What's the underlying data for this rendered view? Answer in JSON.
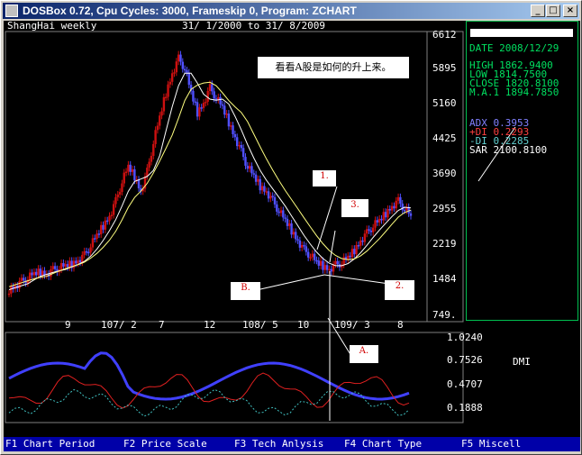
{
  "window": {
    "title": "DOSBox 0.72, Cpu Cycles:     3000, Frameskip  0, Program:   ZCHART",
    "minimize_glyph": "_",
    "maximize_glyph": "□",
    "close_glyph": "×"
  },
  "chart_header": {
    "symbol": "ShangHai weekly",
    "date_range": "31/ 1/2000 to 31/ 8/2009"
  },
  "annotation": {
    "caption": "看看A股是如何的升上来。",
    "labels": [
      "1.",
      "3.",
      "B.",
      "2.",
      "A."
    ]
  },
  "info": {
    "date": "DATE 2008/12/29",
    "high": "HIGH   1862.9400",
    "low": "LOW    1814.7500",
    "close": "CLOSE  1820.8100",
    "ma": "M.A.1  1894.7850",
    "adx": "ADX        0.3953",
    "pdi": "+DI        0.2293",
    "mdi": "-DI        0.2285",
    "sar": "SAR    2100.8100"
  },
  "price_axis_labels": [
    "6612",
    "5895",
    "5160",
    "4425",
    "3690",
    "2955",
    "2219",
    "1484",
    "749."
  ],
  "time_axis_labels": [
    "9",
    "107/ 2",
    "7",
    "12",
    "108/ 5",
    "10",
    "109/ 3",
    "8"
  ],
  "dmi_axis_labels": [
    "1.0240",
    "0.7526",
    "0.4707",
    "0.1888"
  ],
  "dmi_title": "DMI",
  "menu": [
    "F1 Chart Period",
    "F2 Price Scale",
    "F3 Tech Anlysis",
    "F4 Chart Type",
    "F5 Miscell"
  ],
  "colors": {
    "candle_up": "#cc1010",
    "candle_down": "#5050ff",
    "ma_line": "#ffffff",
    "ma_line2": "#ffff80",
    "adx_line": "#4040ff",
    "pdi_line": "#e02020",
    "mdi_line": "#40c0c0",
    "panel_border": "#00c050"
  },
  "chart_data": {
    "type": "candlestick",
    "price_axis": [
      749,
      6612
    ],
    "close_series": [
      1400,
      1480,
      1560,
      1640,
      1720,
      1760,
      1720,
      1800,
      1850,
      1880,
      1920,
      2000,
      2100,
      2300,
      2500,
      2700,
      2900,
      3200,
      3600,
      3900,
      3700,
      3400,
      3800,
      4400,
      4900,
      5400,
      5800,
      6100,
      5900,
      5400,
      5000,
      5200,
      5500,
      5300,
      5100,
      4800,
      4500,
      4200,
      3900,
      3700,
      3500,
      3400,
      3200,
      3000,
      2800,
      2600,
      2400,
      2200,
      2100,
      1950,
      1880,
      1820,
      1900,
      1950,
      2050,
      2200,
      2400,
      2550,
      2700,
      2800,
      2950,
      3100,
      3200,
      3050,
      2900
    ]
  }
}
